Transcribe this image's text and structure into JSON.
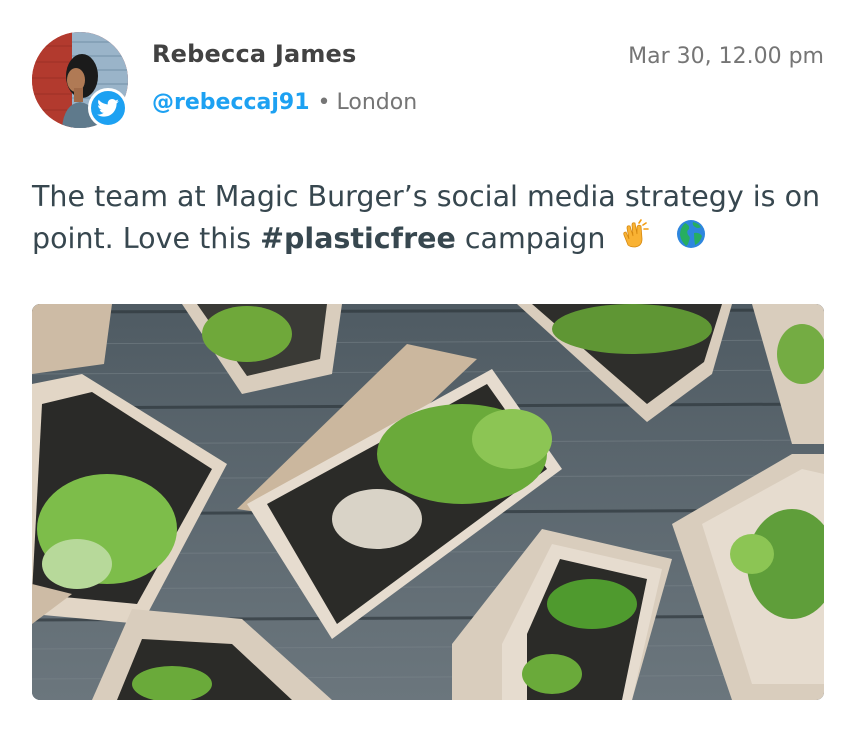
{
  "tweet": {
    "author_name": "Rebecca James",
    "handle": "@rebeccaj91",
    "separator": "•",
    "location": "London",
    "timestamp": "Mar 30, 12.00 pm",
    "text_part1": "The team at Magic Burger’s social media strategy is on point. Love this ",
    "hashtag": "#plasticfree",
    "text_part2": " campaign",
    "emojis": [
      "clapping-hands",
      "globe-europe-africa"
    ]
  },
  "colors": {
    "twitter_blue": "#1da1f2",
    "text": "#37474f",
    "muted": "#757575"
  },
  "icons": {
    "badge": "twitter-bird-icon"
  },
  "image": {
    "subject": "plant seedlings in cardboard trays on wooden table"
  }
}
